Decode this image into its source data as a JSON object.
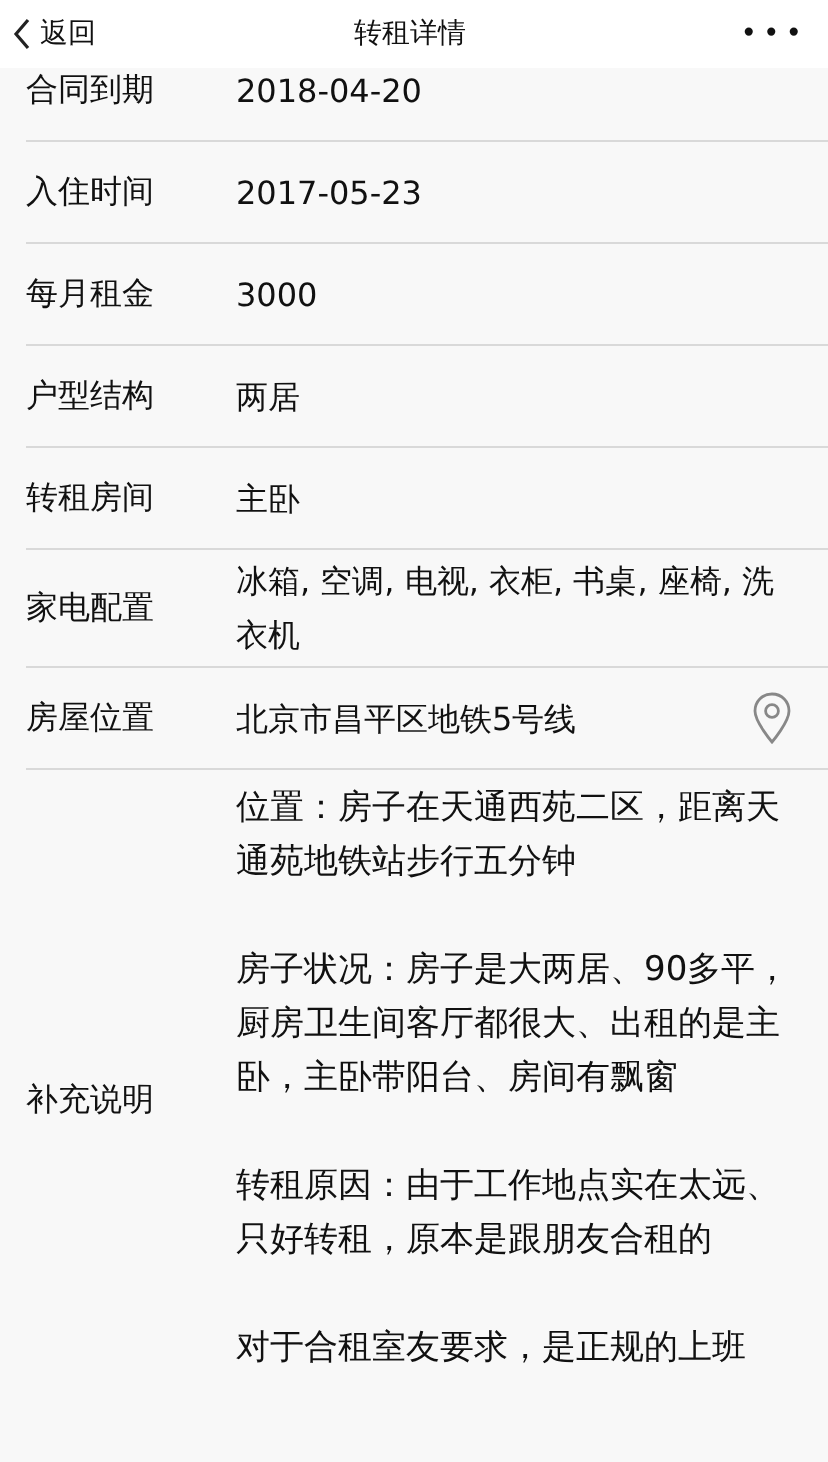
{
  "nav": {
    "back": "返回",
    "title": "转租详情",
    "more": "•••"
  },
  "rows": [
    {
      "label": "合同到期",
      "value": "2018-04-20"
    },
    {
      "label": "入住时间",
      "value": "2017-05-23"
    },
    {
      "label": "每月租金",
      "value": "3000"
    },
    {
      "label": "户型结构",
      "value": "两居"
    },
    {
      "label": "转租房间",
      "value": "主卧"
    },
    {
      "label": "家电配置",
      "value": "冰箱, 空调, 电视, 衣柜, 书桌, 座椅, 洗衣机"
    },
    {
      "label": "房屋位置",
      "value": "北京市昌平区地铁5号线",
      "kind": "location"
    }
  ],
  "notes": {
    "label": "补充说明",
    "paragraphs": [
      "位置：房子在天通西苑二区，距离天通苑地铁站步行五分钟",
      "房子状况：房子是大两居、90多平，厨房卫生间客厅都很大、出租的是主卧，主卧带阳台、房间有飘窗",
      "转租原因：由于工作地点实在太远、只好转租，原本是跟朋友合租的",
      "对于合租室友要求，是正规的上班"
    ]
  }
}
